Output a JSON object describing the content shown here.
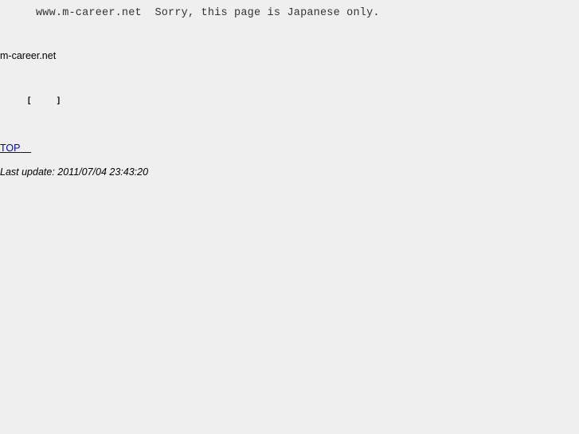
{
  "notice": {
    "site": "www.m-career.net",
    "message": "Sorry, this page is Japanese only."
  },
  "site_name": "m-career.net",
  "bracket_line": {
    "open": "[",
    "close": "]"
  },
  "top_link": {
    "label": "TOP"
  },
  "last_update": "Last update: 2011/07/04 23:43:20"
}
